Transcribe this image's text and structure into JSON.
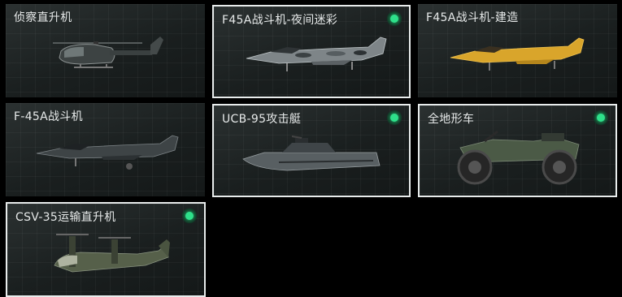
{
  "vehicles": [
    {
      "label": "侦察直升机",
      "equipped": false
    },
    {
      "label": "F45A战斗机-夜间迷彩",
      "equipped": true
    },
    {
      "label": "F45A战斗机-建造",
      "equipped": false
    },
    {
      "label": "F-45A战斗机",
      "equipped": false
    },
    {
      "label": "UCB-95攻击艇",
      "equipped": true
    },
    {
      "label": "全地形车",
      "equipped": true
    },
    {
      "label": "CSV-35运输直升机",
      "equipped": true
    }
  ],
  "colors": {
    "equipped_dot": "#2ee08a",
    "selected_border": "#e8ecec",
    "background": "#000000"
  },
  "icons": [
    "helicopter-icon",
    "jet-camo-icon",
    "jet-yellow-icon",
    "jet-dark-icon",
    "boat-icon",
    "atv-icon",
    "tiltrotor-icon"
  ]
}
